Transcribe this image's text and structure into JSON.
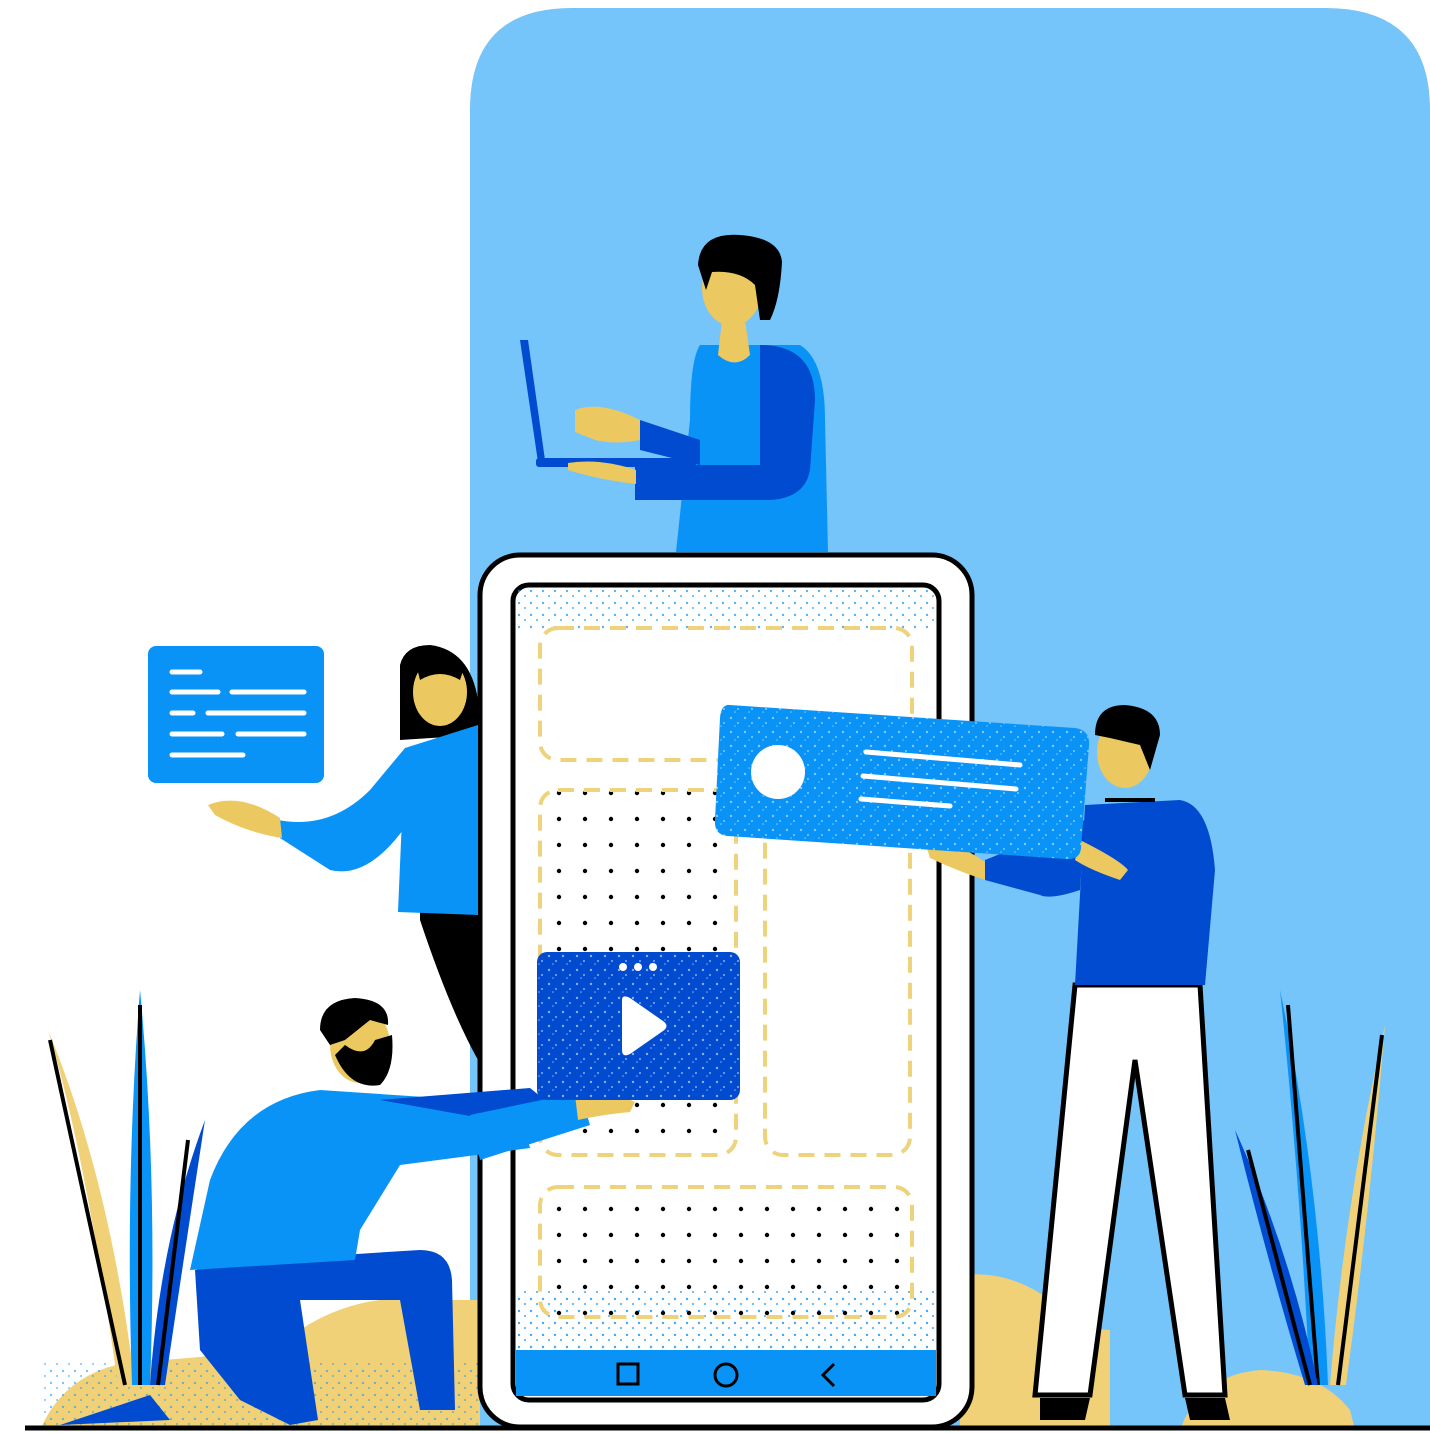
{
  "illustration": {
    "subject": "team-building-mobile-app",
    "colors": {
      "sky_panel": "#75C4FA",
      "primary_blue": "#0A93F7",
      "dark_blue": "#004BCF",
      "sand": "#F1D178",
      "skin": "#EBC860",
      "outline": "#000000",
      "white": "#FFFFFF",
      "dashed_slot": "#EFD27C"
    },
    "phone": {
      "nav_buttons": [
        "square-icon",
        "circle-icon",
        "back-chevron-icon"
      ]
    },
    "cards": {
      "text_card": "text-lines-card",
      "video_card": "video-player-card",
      "profile_card": "profile-card"
    },
    "people": [
      "man-with-laptop",
      "woman-pointing",
      "bearded-man-kneeling",
      "man-holding-card"
    ]
  }
}
